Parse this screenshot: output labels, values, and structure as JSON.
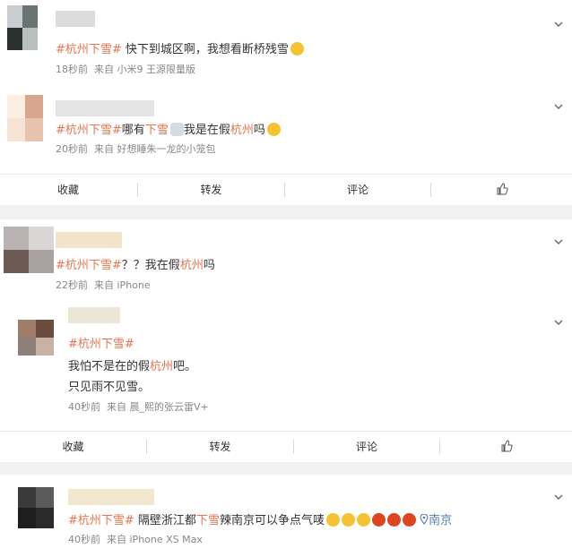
{
  "posts": [
    {
      "hashtag": "#杭州下雪#",
      "text_before": " 快下到城区啊，我想看断桥残雪",
      "time": "18秒前",
      "from": "来自",
      "source": "小米9 王源限量版"
    },
    {
      "hashtag": "#杭州下雪#",
      "text_a": "哪有",
      "text_b": "下雪",
      "text_c": "我是在假",
      "text_d": "杭州",
      "text_e": "吗",
      "time": "20秒前",
      "from": "来自",
      "source": "好想睡朱一龙的小笼包"
    },
    {
      "hashtag": "#杭州下雪#",
      "text_a": "？？我在假",
      "text_b": "杭州",
      "text_c": "吗",
      "time": "22秒前",
      "from": "来自",
      "source": "iPhone"
    },
    {
      "hashtag": "#杭州下雪#",
      "line1_a": "我怕不是在的假",
      "line1_b": "杭州",
      "line1_c": "吧。",
      "line2": "只见雨不见雪。",
      "time": "40秒前",
      "from": "来自",
      "source": "晨_熙的张云雷V+"
    },
    {
      "hashtag": "#杭州下雪#",
      "text_a": " 隔壁浙江都",
      "text_b": "下雪",
      "text_c": "辣南京可以争点气唛",
      "location": "南京",
      "time": "40秒前",
      "from": "来自",
      "source": "iPhone XS Max"
    }
  ],
  "action_bar": {
    "favorite": "收藏",
    "repost": "转发",
    "comment": "评论"
  },
  "colors": {
    "accent": "#eb7350",
    "link": "#507daf",
    "meta": "#888888",
    "gap": "#f2f2f5"
  }
}
